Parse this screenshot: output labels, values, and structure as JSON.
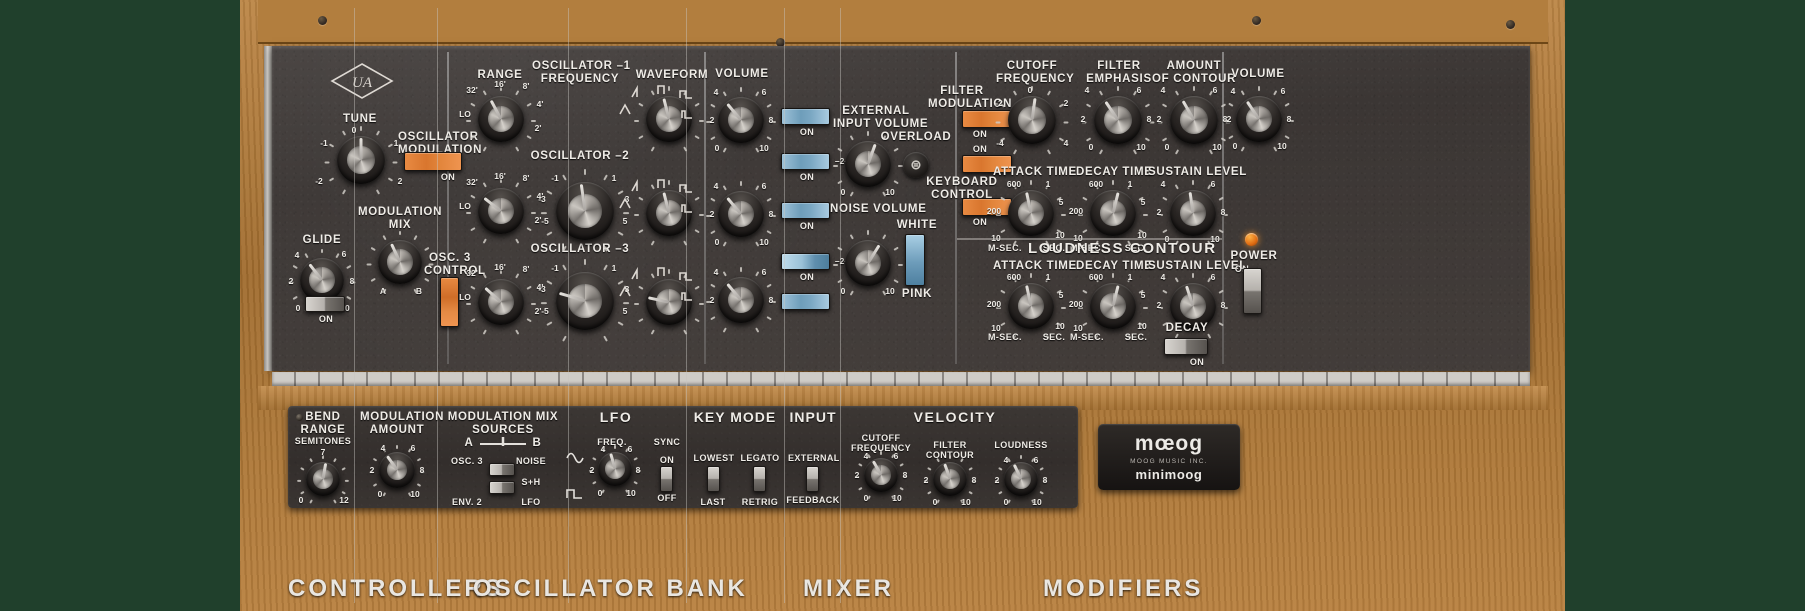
{
  "app": {
    "brand": "UA",
    "product": "minimoog",
    "maker": "MOOG MUSIC INC."
  },
  "sections": {
    "controllers": {
      "title": "CONTROLLERS",
      "tune": {
        "label": "TUNE",
        "ticks": [
          "-2",
          "-1",
          "0",
          "1",
          "2"
        ]
      },
      "oscillator_modulation": {
        "label": "OSCILLATOR\nMODULATION",
        "state": "ON",
        "color": "#e0802f"
      },
      "glide": {
        "label": "GLIDE",
        "ticks": [
          "0",
          "2",
          "4",
          "6",
          "8",
          "10"
        ],
        "switch_label": "ON"
      },
      "modulation_mix": {
        "label": "MODULATION\nMIX",
        "ticks": [
          "A",
          "B"
        ]
      }
    },
    "oscillator_bank": {
      "title": "OSCILLATOR BANK",
      "range_label": "RANGE",
      "range_ticks": [
        "LO",
        "32'",
        "16'",
        "8'",
        "4'",
        "2'"
      ],
      "freq_label_1": "OSCILLATOR –1\nFREQUENCY",
      "freq_label_2": "OSCILLATOR –2",
      "freq_label_3": "OSCILLATOR –3",
      "waveform_label": "WAVEFORM",
      "freq_ticks": [
        "-5",
        "-3",
        "-1",
        "1",
        "3",
        "5"
      ],
      "osc3_control": {
        "label": "OSC. 3\nCONTROL",
        "state": "on",
        "color": "#e0802f"
      }
    },
    "mixer": {
      "title": "MIXER",
      "volume_label": "VOLUME",
      "volume_ticks": [
        "0",
        "2",
        "4",
        "6",
        "8",
        "10"
      ],
      "external_input_volume": "EXTERNAL\nINPUT VOLUME",
      "noise_volume": "NOISE VOLUME",
      "overload": "OVERLOAD",
      "white": "WHITE",
      "pink": "PINK",
      "switch_on": "ON",
      "switch_2": "–2–",
      "rows": [
        {
          "name": "osc1",
          "on": "ON"
        },
        {
          "name": "ext-input",
          "on": "ON"
        },
        {
          "name": "osc2",
          "on": "ON"
        },
        {
          "name": "noise",
          "on": "ON"
        },
        {
          "name": "osc3",
          "on": "ON"
        }
      ]
    },
    "modifiers": {
      "title": "MODIFIERS",
      "filter_modulation": {
        "label": "FILTER\nMODULATION",
        "state": "ON"
      },
      "keyboard_control": {
        "label": "KEYBOARD\nCONTROL",
        "state": "ON",
        "upper_on": "ON"
      },
      "cutoff_frequency": {
        "label": "CUTOFF\nFREQUENCY",
        "ticks": [
          "-4",
          "-2",
          "0",
          "2",
          "4"
        ]
      },
      "filter_emphasis": {
        "label": "FILTER\nEMPHASIS",
        "ticks": [
          "0",
          "2",
          "4",
          "6",
          "8",
          "10"
        ]
      },
      "amount_of_contour": {
        "label": "AMOUNT\nOF CONTOUR",
        "ticks": [
          "0",
          "2",
          "4",
          "6",
          "8",
          "10"
        ]
      },
      "filter_contour": {
        "attack_time": {
          "label": "ATTACK TIME",
          "ticks": [
            "10",
            "200",
            "600",
            "1",
            "5",
            "10"
          ],
          "units": [
            "M-SEC.",
            "SEC."
          ]
        },
        "decay_time": {
          "label": "DECAY TIME",
          "ticks": [
            "10",
            "200",
            "600",
            "1",
            "5",
            "10"
          ],
          "units": [
            "M-SEC.",
            "SEC."
          ]
        },
        "sustain_level": {
          "label": "SUSTAIN LEVEL",
          "ticks": [
            "0",
            "2",
            "4",
            "6",
            "8",
            "10"
          ]
        }
      },
      "loudness_contour": {
        "title": "LOUDNESS CONTOUR",
        "attack_time": {
          "label": "ATTACK TIME",
          "ticks": [
            "10",
            "200",
            "600",
            "1",
            "5",
            "10"
          ],
          "units": [
            "M-SEC.",
            "SEC."
          ]
        },
        "decay_time": {
          "label": "DECAY TIME",
          "ticks": [
            "10",
            "200",
            "600",
            "1",
            "5",
            "10"
          ],
          "units": [
            "M-SEC.",
            "SEC."
          ]
        },
        "sustain_level": {
          "label": "SUSTAIN LEVEL",
          "ticks": [
            "0",
            "2",
            "4",
            "6",
            "8",
            "10"
          ]
        },
        "decay_switch": {
          "label": "DECAY",
          "state": "ON"
        }
      }
    },
    "output": {
      "volume": {
        "label": "VOLUME",
        "ticks": [
          "0",
          "2",
          "4",
          "6",
          "8",
          "10"
        ]
      },
      "power": {
        "label": "POWER",
        "state": "ON"
      }
    }
  },
  "lower_panel": {
    "bend_range": {
      "label": "BEND\nRANGE",
      "sub": "SEMITONES",
      "ticks": [
        "0",
        "7",
        "12"
      ]
    },
    "modulation_amount": {
      "label": "MODULATION\nAMOUNT",
      "ticks": [
        "0",
        "2",
        "4",
        "6",
        "8",
        "10"
      ]
    },
    "modulation_mix_sources": {
      "label": "MODULATION MIX\nSOURCES",
      "a": "A",
      "b": "B",
      "left_top": "OSC. 3",
      "left_bottom": "ENV. 2",
      "right_top": "NOISE",
      "right_mid": "S+H",
      "right_bottom": "LFO"
    },
    "lfo": {
      "label": "LFO",
      "freq": "FREQ.",
      "sync": "SYNC",
      "on": "ON",
      "off": "OFF",
      "ticks": [
        "0",
        "2",
        "4",
        "6",
        "8",
        "10"
      ]
    },
    "key_mode": {
      "label": "KEY MODE",
      "lowest": "LOWEST",
      "legato": "LEGATO",
      "last": "LAST",
      "retrig": "RETRIG"
    },
    "input": {
      "label": "INPUT",
      "external": "EXTERNAL",
      "feedback": "FEEDBACK"
    },
    "velocity": {
      "label": "VELOCITY",
      "cutoff_frequency": {
        "label": "CUTOFF\nFREQUENCY",
        "ticks": [
          "0",
          "2",
          "4",
          "6",
          "8",
          "10"
        ]
      },
      "filter_contour": {
        "label": "FILTER\nCONTOUR",
        "ticks": [
          "0",
          "2",
          "4",
          "6",
          "8",
          "10"
        ]
      },
      "loudness": {
        "label": "LOUDNESS",
        "ticks": [
          "0",
          "2",
          "4",
          "6",
          "8",
          "10"
        ]
      }
    }
  }
}
